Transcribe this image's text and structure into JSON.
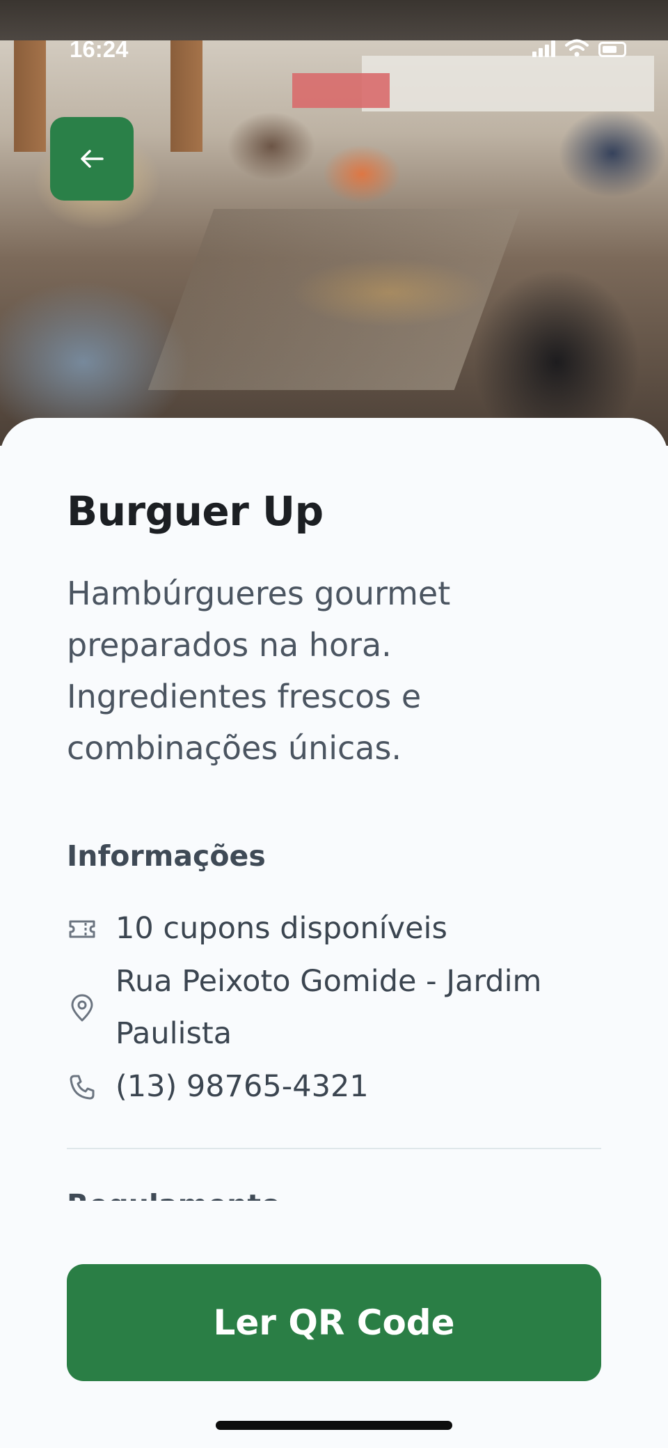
{
  "status_bar": {
    "time": "16:24"
  },
  "hero": {
    "image_description": "",
    "back_icon": "arrow-left-icon"
  },
  "place": {
    "name": "Burguer Up",
    "description": "Hambúrgueres gourmet preparados na hora. Ingredientes frescos e combinações únicas."
  },
  "info": {
    "heading": "Informações",
    "items": [
      {
        "icon": "ticket-icon",
        "text": "10 cupons disponíveis"
      },
      {
        "icon": "map-pin-icon",
        "text": "Rua Peixoto Gomide - Jardim Paulista"
      },
      {
        "icon": "phone-icon",
        "text": "(13) 98765-4321"
      }
    ]
  },
  "rules": {
    "heading": "Regulamento"
  },
  "cta": {
    "label": "Ler QR Code"
  },
  "colors": {
    "primary": "#2a7e45",
    "background": "#f9fbfd",
    "title": "#1c1f23",
    "body_text": "#4b5561"
  }
}
